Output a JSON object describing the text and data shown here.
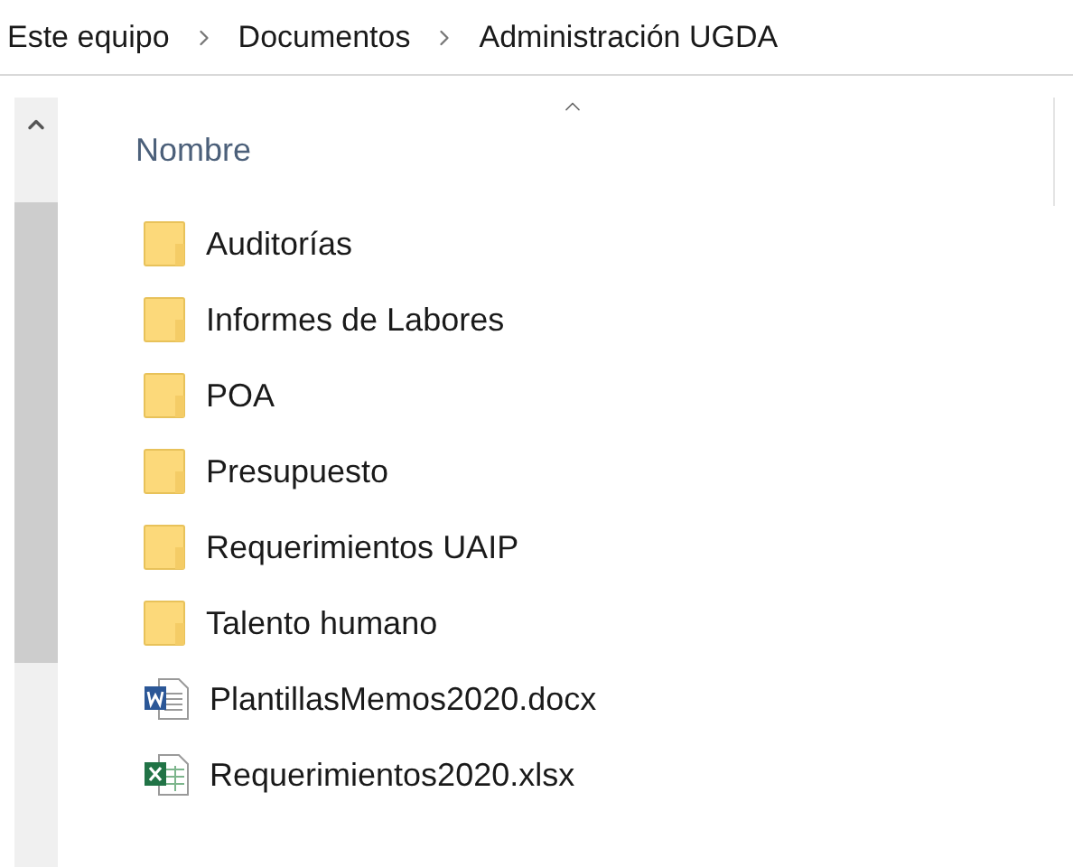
{
  "breadcrumb": [
    "Este equipo",
    "Documentos",
    "Administración UGDA"
  ],
  "column_header": {
    "label": "Nombre"
  },
  "items": [
    {
      "name": "Auditorías",
      "kind": "folder"
    },
    {
      "name": "Informes de Labores",
      "kind": "folder"
    },
    {
      "name": "POA",
      "kind": "folder"
    },
    {
      "name": "Presupuesto",
      "kind": "folder"
    },
    {
      "name": "Requerimientos UAIP",
      "kind": "folder"
    },
    {
      "name": "Talento humano",
      "kind": "folder"
    },
    {
      "name": "PlantillasMemos2020.docx",
      "kind": "word"
    },
    {
      "name": "Requerimientos2020.xlsx",
      "kind": "excel"
    }
  ]
}
